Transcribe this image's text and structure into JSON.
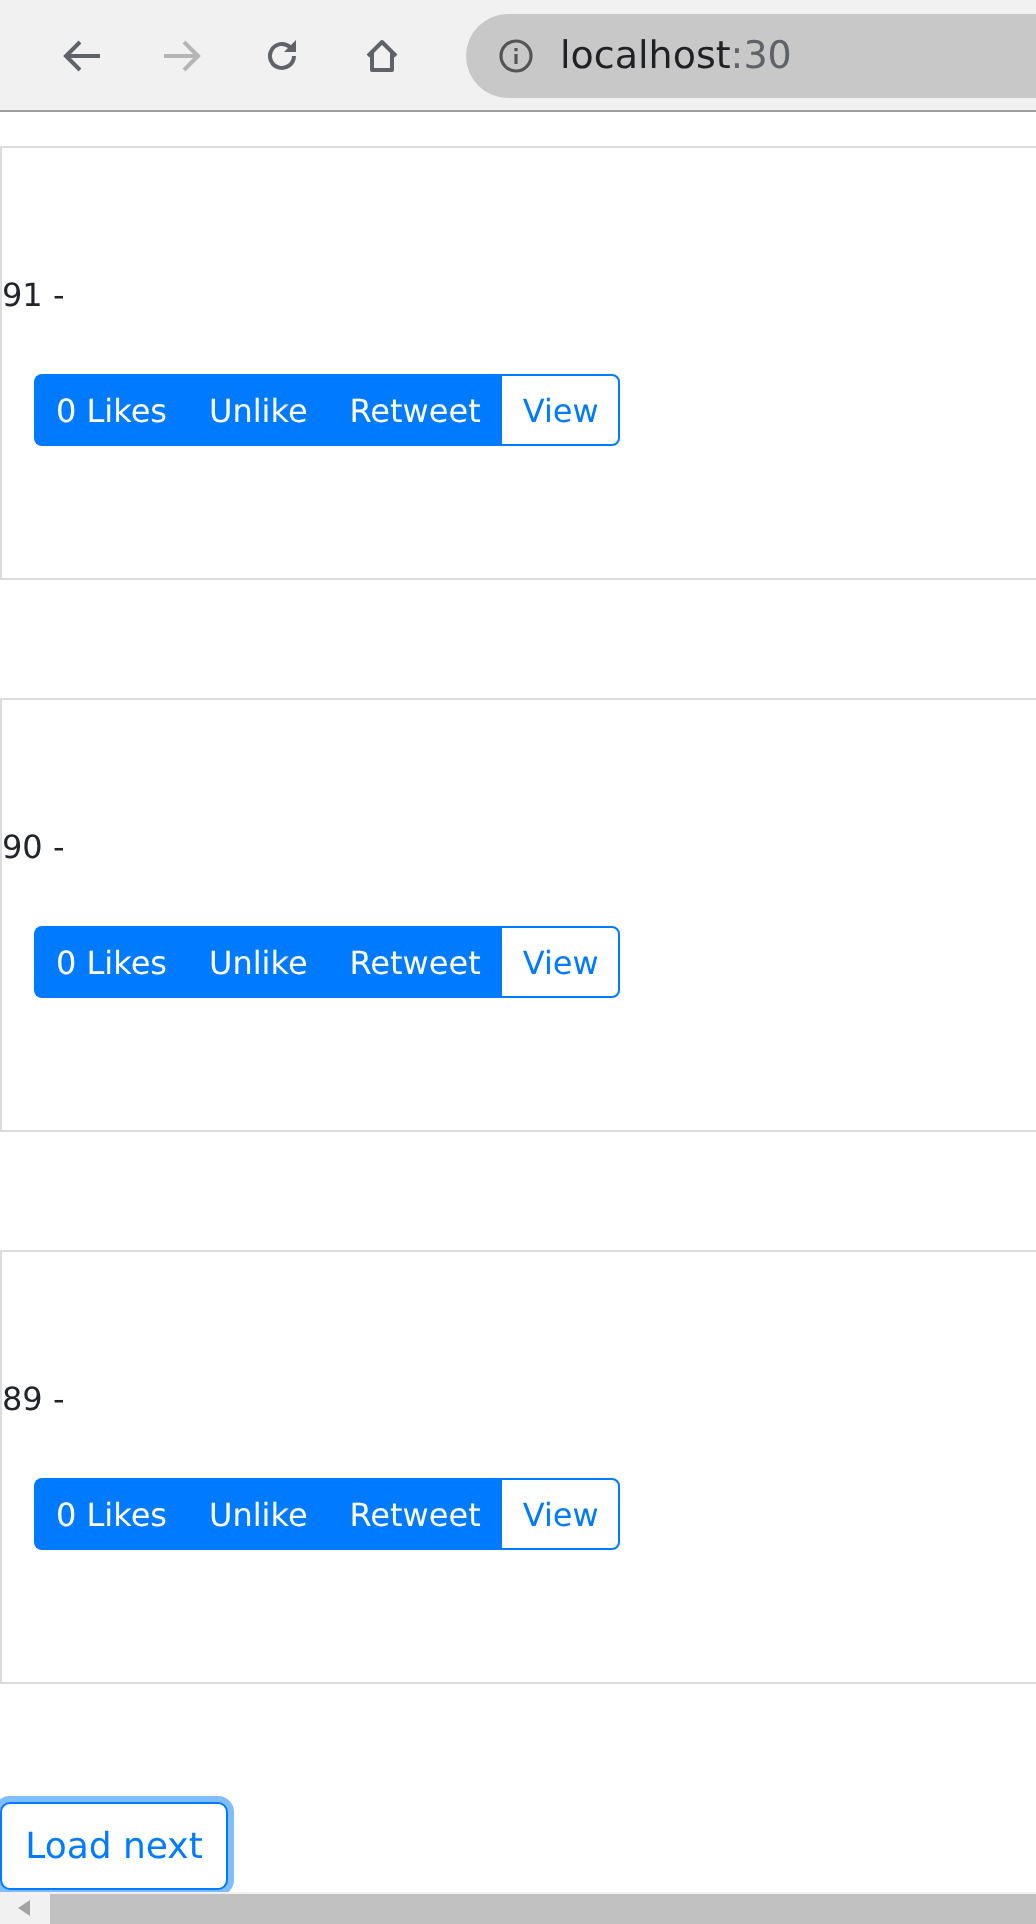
{
  "browser": {
    "back_disabled": false,
    "forward_disabled": true,
    "url_host": "localhost",
    "url_port": ":30"
  },
  "posts": [
    {
      "text": "91 -",
      "buttons": [
        {
          "label": "0 Likes",
          "kind": "solid"
        },
        {
          "label": "Unlike",
          "kind": "solid"
        },
        {
          "label": "Retweet",
          "kind": "solid"
        },
        {
          "label": "View",
          "kind": "outline"
        }
      ]
    },
    {
      "text": "90 -",
      "buttons": [
        {
          "label": "0 Likes",
          "kind": "solid"
        },
        {
          "label": "Unlike",
          "kind": "solid"
        },
        {
          "label": "Retweet",
          "kind": "solid"
        },
        {
          "label": "View",
          "kind": "outline"
        }
      ]
    },
    {
      "text": "89 -",
      "buttons": [
        {
          "label": "0 Likes",
          "kind": "solid"
        },
        {
          "label": "Unlike",
          "kind": "solid"
        },
        {
          "label": "Retweet",
          "kind": "solid"
        },
        {
          "label": "View",
          "kind": "outline"
        }
      ]
    }
  ],
  "load_next": {
    "label": "Load next",
    "focused": true
  }
}
